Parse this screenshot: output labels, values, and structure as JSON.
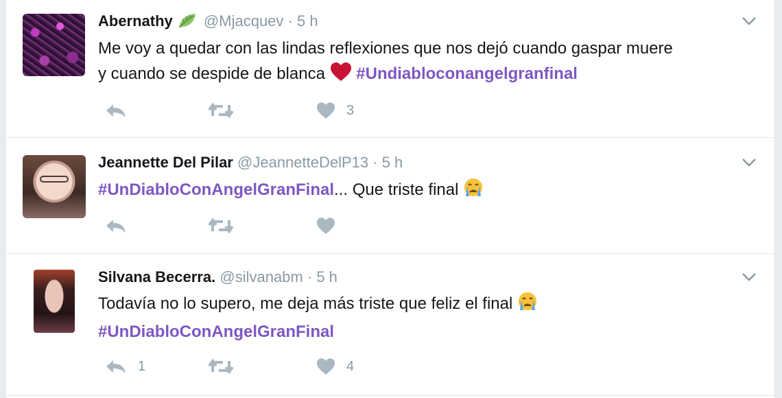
{
  "colors": {
    "hashtag": "#7e57c2",
    "muted": "#8899a6",
    "heart": "#c81337"
  },
  "tweets": [
    {
      "name": "Abernathy",
      "badge_icon": "leaf-icon",
      "handle": "@Mjacquev",
      "dot": "·",
      "time": "5 h",
      "text_line1": "Me voy a quedar con las lindas reflexiones que nos dejó cuando gaspar muere",
      "text_line2": "y cuando se despide de blanca",
      "emoji": "heart-emoji",
      "hashtag": "#Undiabloconangelgranfinal",
      "reply_count": "",
      "retweet_count": "",
      "like_count": "3"
    },
    {
      "name": "Jeannette Del Pilar",
      "handle": "@JeannetteDelP13",
      "dot": "·",
      "time": "5 h",
      "hashtag": "#UnDiabloConAngelGranFinal",
      "text_after": "... Que triste final",
      "emoji": "crying-face-emoji",
      "reply_count": "",
      "retweet_count": "",
      "like_count": ""
    },
    {
      "name": "Silvana Becerra.",
      "handle": "@silvanabm",
      "dot": "·",
      "time": "5 h",
      "text_line1": "Todavía no lo supero, me deja más triste que feliz el final",
      "emoji": "crying-face-emoji",
      "hashtag": "#UnDiabloConAngelGranFinal",
      "reply_count": "1",
      "retweet_count": "",
      "like_count": "4"
    }
  ]
}
